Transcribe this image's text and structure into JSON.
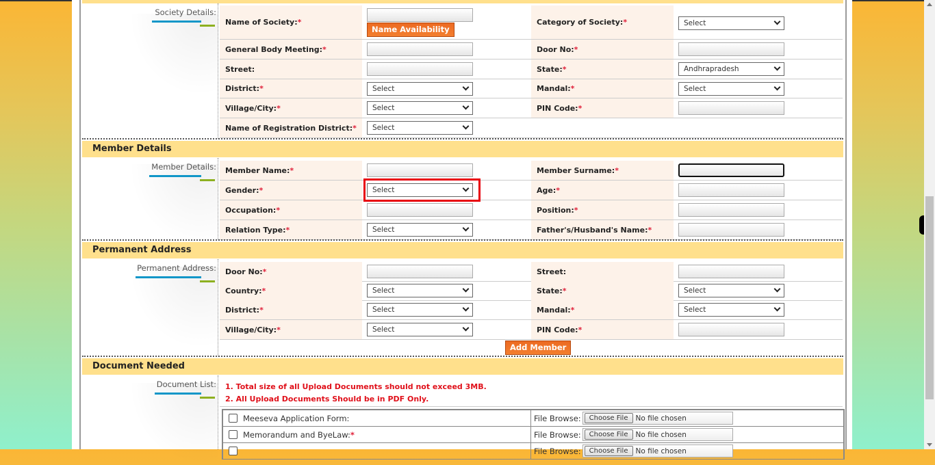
{
  "society_section": {
    "label": "Society Details:",
    "name_availability_button": "Name Availability",
    "rows": [
      {
        "l1": "Name of  Society:",
        "r1": true,
        "c1": "input",
        "l2": "Category of Society:",
        "r2": true,
        "c2": "select",
        "v2": "Select"
      },
      {
        "l1": "General Body Meeting:",
        "r1": true,
        "c1": "input",
        "l2": "Door No:",
        "r2": true,
        "c2": "input"
      },
      {
        "l1": "Street:",
        "r1": false,
        "c1": "input",
        "l2": "State:",
        "r2": true,
        "c2": "select",
        "v2": "Andhrapradesh"
      },
      {
        "l1": "District:",
        "r1": true,
        "c1": "select",
        "v1": "Select",
        "l2": "Mandal:",
        "r2": true,
        "c2": "select",
        "v2": "Select"
      },
      {
        "l1": "Village/City:",
        "r1": true,
        "c1": "select",
        "v1": "Select",
        "l2": "PIN Code:",
        "r2": true,
        "c2": "input"
      },
      {
        "l1": "Name of Registration District:",
        "r1": true,
        "c1": "select",
        "v1": "Select"
      }
    ]
  },
  "member_section": {
    "title": "Member Details",
    "label": "Member Details:",
    "rows": [
      {
        "l1": "Member Name:",
        "l2": "Member Surname:"
      },
      {
        "l1": "Gender:",
        "v1": "Select",
        "l2": "Age:"
      },
      {
        "l1": "Occupation:",
        "l2": "Position:"
      },
      {
        "l1": "Relation Type:",
        "v1": "Select",
        "l2": "Father's/Husband's Name:"
      }
    ]
  },
  "address_section": {
    "title": "Permanent Address",
    "label": "Permanent Address:",
    "rows": [
      {
        "l1": "Door No:",
        "l2": "Street:"
      },
      {
        "l1": "Country:",
        "v1": "Select",
        "l2": "State:",
        "v2": "Select"
      },
      {
        "l1": "District:",
        "v1": "Select",
        "l2": "Mandal:",
        "v2": "Select"
      },
      {
        "l1": "Village/City:",
        "v1": "Select",
        "l2": "PIN Code:"
      }
    ],
    "add_member_button": "Add Member"
  },
  "document_section": {
    "title": "Document Needed",
    "label": "Document List:",
    "notices": [
      "1. Total size of all Upload Documents should not exceed 3MB.",
      "2. All Upload Documents Should be in PDF Only."
    ],
    "file_browse_label": "File Browse:",
    "choose_file_label": "Choose File",
    "no_file_text": "No file chosen",
    "documents": [
      {
        "name": "Meeseva Application Form:",
        "required": false
      },
      {
        "name": "Memorandum and ByeLaw:",
        "required": true
      }
    ]
  },
  "required_marker": "*",
  "colors": {
    "section_header": "#ffe08c",
    "label_bg": "#fdf2e9",
    "button_orange": "#ec6a22",
    "required": "#e0213a",
    "highlight": "#e8000b"
  }
}
